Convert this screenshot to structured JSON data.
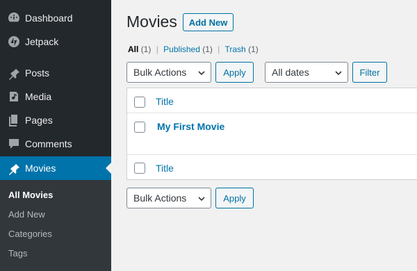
{
  "sidebar": {
    "items": [
      {
        "label": "Dashboard",
        "icon": "dashboard-icon"
      },
      {
        "label": "Jetpack",
        "icon": "jetpack-icon"
      },
      {
        "label": "Posts",
        "icon": "pin-icon"
      },
      {
        "label": "Media",
        "icon": "media-icon"
      },
      {
        "label": "Pages",
        "icon": "pages-icon"
      },
      {
        "label": "Comments",
        "icon": "comments-icon"
      },
      {
        "label": "Movies",
        "icon": "pin-icon",
        "active": true
      }
    ],
    "submenu": [
      "All Movies",
      "Add New",
      "Categories",
      "Tags"
    ]
  },
  "page": {
    "title": "Movies",
    "add_new": "Add New"
  },
  "views": {
    "all": "All",
    "all_count": "(1)",
    "published": "Published",
    "published_count": "(1)",
    "trash": "Trash",
    "trash_count": "(1)",
    "separator": "|"
  },
  "filters": {
    "bulk_actions": "Bulk Actions",
    "apply": "Apply",
    "dates": "All dates",
    "filter": "Filter"
  },
  "table": {
    "column_title": "Title",
    "rows": [
      {
        "title": "My First Movie"
      }
    ]
  },
  "colors": {
    "accent": "#0073aa",
    "sidebar": "#23282d",
    "active": "#0073aa"
  }
}
